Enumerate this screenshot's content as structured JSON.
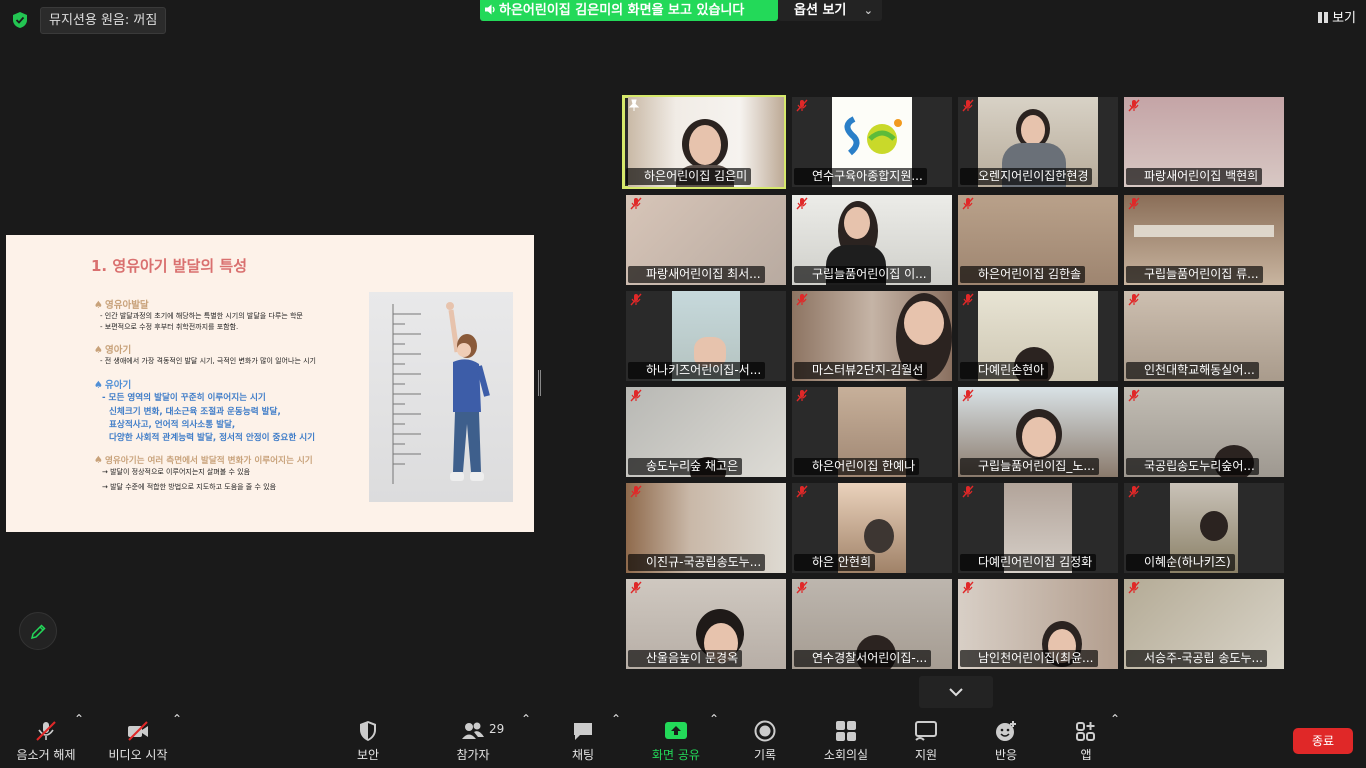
{
  "top": {
    "audio_status": "뮤지션용 원음: 꺼짐",
    "share_banner": "하은어린이집 김은미의 화면을 보고 있습니다",
    "options_label": "옵션 보기",
    "view_label": "보기"
  },
  "slide": {
    "title": "1. 영유아기 발달의 특성",
    "sections": [
      {
        "heading": "영유아발달",
        "color": "tan",
        "lines": [
          "- 인간 발달과정의 초기에 해당하는 특별한 시기의 발달을 다루는 학문",
          "- 보편적으로 수정 후부터 취학전까지를 포함함."
        ]
      },
      {
        "heading": "영아기",
        "color": "tan",
        "lines": [
          "- 전 생애에서 가장 격동적인 발달 시기, 극적인 변화가 많이 일어나는 시기"
        ]
      },
      {
        "heading": "유아기",
        "color": "blue",
        "lines": [
          "- 모든 영역의 발달이 꾸준히 이루어지는 시기",
          "신체크기 변화,  대소근육 조절과 운동능력 발달,",
          "표상적사고,   언어적 의사소통 발달,",
          "다양한 사회적 관계능력 발달, 정서적 안정이 중요한 시기"
        ]
      },
      {
        "heading": "영유아기는 여러 측면에서 발달적 변화가 이루어지는 시기",
        "color": "tan",
        "lines": [
          "→ 발달이 정상적으로 이루어지는지 살펴볼 수 있음",
          "→ 발달 수준에 적합한 방법으로 지도하고 도움을 줄 수 있음"
        ]
      }
    ]
  },
  "participants": [
    {
      "name": "하은어린이집 김은미",
      "active": true,
      "muted": false
    },
    {
      "name": "연수구육아종합지원...",
      "active": false,
      "muted": true
    },
    {
      "name": "오렌지어린이집한현경",
      "active": false,
      "muted": true
    },
    {
      "name": "파랑새어린이집 백현희",
      "active": false,
      "muted": true
    },
    {
      "name": "파랑새어린이집  최서...",
      "active": false,
      "muted": true
    },
    {
      "name": "구립늘품어린이집 이...",
      "active": false,
      "muted": true
    },
    {
      "name": "하은어린이집 김한솔",
      "active": false,
      "muted": true
    },
    {
      "name": "구립늘품어린이집 류...",
      "active": false,
      "muted": true
    },
    {
      "name": "하나키즈어린이집-서...",
      "active": false,
      "muted": true
    },
    {
      "name": "마스터뷰2단지-김월선",
      "active": false,
      "muted": true
    },
    {
      "name": "다예린손현아",
      "active": false,
      "muted": true
    },
    {
      "name": "인천대학교해동실어...",
      "active": false,
      "muted": true
    },
    {
      "name": "송도누리숲 채고은",
      "active": false,
      "muted": true
    },
    {
      "name": "하은어린이집 한예나",
      "active": false,
      "muted": true
    },
    {
      "name": "구립늘품어린이집_노...",
      "active": false,
      "muted": true
    },
    {
      "name": "국공립송도누리숲어...",
      "active": false,
      "muted": true
    },
    {
      "name": "이진규-국공립송도누...",
      "active": false,
      "muted": true
    },
    {
      "name": "하은 안현희",
      "active": false,
      "muted": true
    },
    {
      "name": "다예린어린이집 김정화",
      "active": false,
      "muted": true
    },
    {
      "name": "이혜순(하나키즈)",
      "active": false,
      "muted": true
    },
    {
      "name": "산울음높이 문경옥",
      "active": false,
      "muted": true
    },
    {
      "name": "연수경찰서어린이집-...",
      "active": false,
      "muted": true
    },
    {
      "name": "남인천어린이집(최윤...",
      "active": false,
      "muted": true
    },
    {
      "name": "서승주-국공립 송도누...",
      "active": false,
      "muted": true
    }
  ],
  "toolbar": {
    "unmute": "음소거 해제",
    "start_video": "비디오 시작",
    "security": "보안",
    "participants": "참가자",
    "participants_count": "29",
    "chat": "채팅",
    "share_screen": "화면 공유",
    "record": "기록",
    "breakout": "소회의실",
    "support": "지원",
    "reactions": "반응",
    "apps": "앱",
    "end": "종료"
  }
}
